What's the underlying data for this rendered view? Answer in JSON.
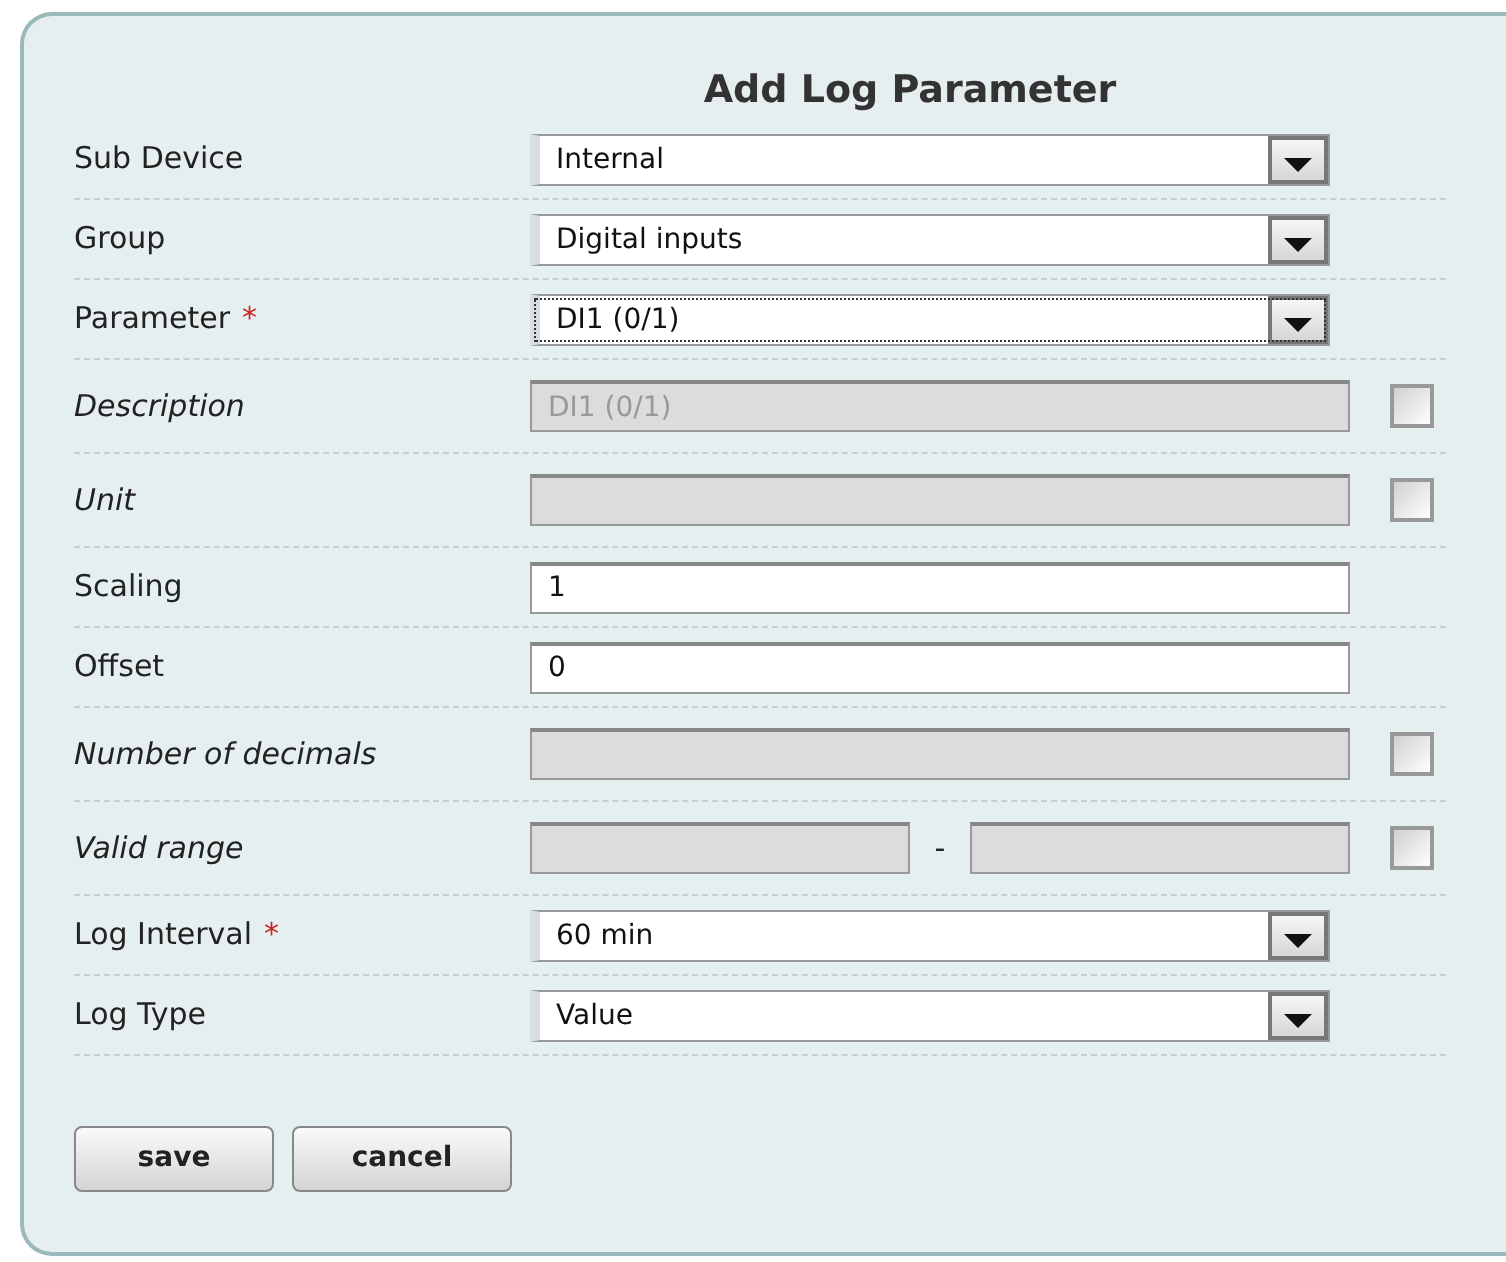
{
  "dialog": {
    "title": "Add Log Parameter"
  },
  "fields": [
    {
      "kind": "select",
      "label": "Sub Device",
      "required": false,
      "value": "Internal",
      "focused": false
    },
    {
      "kind": "select",
      "label": "Group",
      "required": false,
      "value": "Digital inputs",
      "focused": false
    },
    {
      "kind": "select",
      "label": "Parameter",
      "required": true,
      "value": "DI1 (0/1)",
      "focused": true
    },
    {
      "kind": "override",
      "label": "Description",
      "required": false,
      "value": "DI1 (0/1)",
      "disabled": true,
      "checked": false
    },
    {
      "kind": "override",
      "label": "Unit",
      "required": false,
      "disabled": true,
      "checked": false
    },
    {
      "kind": "input",
      "label": "Scaling",
      "required": false,
      "value": "1"
    },
    {
      "kind": "input",
      "label": "Offset",
      "required": false,
      "value": "0"
    },
    {
      "kind": "override",
      "label": "Number of decimals",
      "required": false,
      "disabled": true,
      "checked": false
    },
    {
      "kind": "range",
      "label": "Valid range",
      "required": false,
      "separator": "-",
      "disabled": true,
      "checked": false
    },
    {
      "kind": "select",
      "label": "Log Interval",
      "required": true,
      "value": "60 min",
      "focused": false
    },
    {
      "kind": "select",
      "label": "Log Type",
      "required": false,
      "value": "Value",
      "focused": false
    }
  ],
  "required_mark": "*",
  "buttons": [
    "save",
    "cancel"
  ]
}
